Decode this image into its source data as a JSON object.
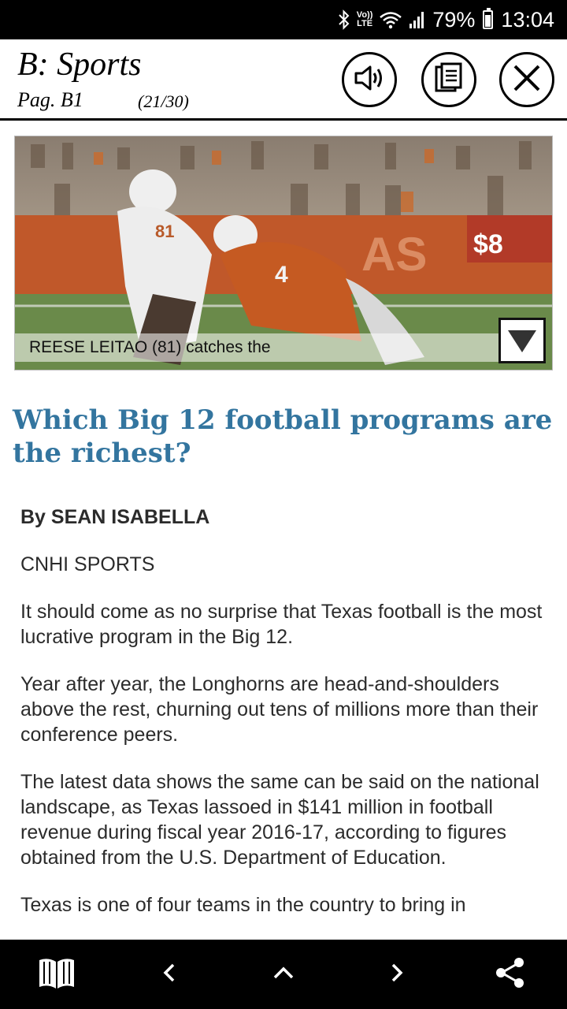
{
  "status_bar": {
    "lte_line1": "Vo))",
    "lte_line2": "LTE",
    "battery": "79%",
    "time": "13:04",
    "icons": [
      "bluetooth-icon",
      "volte-icon",
      "wifi-icon",
      "signal-icon",
      "battery-icon"
    ]
  },
  "header": {
    "section": "B: Sports",
    "page": "Pag. B1",
    "page_count": "(21/30)",
    "buttons": [
      "speaker-icon",
      "pages-icon",
      "close-icon"
    ]
  },
  "photo": {
    "caption": "REESE LEITAO (81) catches the"
  },
  "article": {
    "headline": "Which Big 12 football programs are the richest?",
    "byline": "By SEAN ISABELLA",
    "source": "CNHI SPORTS",
    "paragraphs": [
      "It should come as no surprise that Texas football is the most lucrative program in the Big 12.",
      "Year after year, the Longhorns are head-and-shoulders above the rest, churning out tens of millions more than their conference peers.",
      "The latest data shows the same can be said on the national landscape, as Texas lassoed in $141 million in football revenue during fiscal year 2016-17, according to figures obtained from the U.S. Department of Education.",
      "Texas is one of four teams in the country to bring in"
    ]
  },
  "bottom_nav": [
    "book-icon",
    "chevron-left-icon",
    "chevron-up-icon",
    "chevron-right-icon",
    "share-icon"
  ],
  "colors": {
    "headline": "#33759f",
    "bars": "#000000"
  }
}
